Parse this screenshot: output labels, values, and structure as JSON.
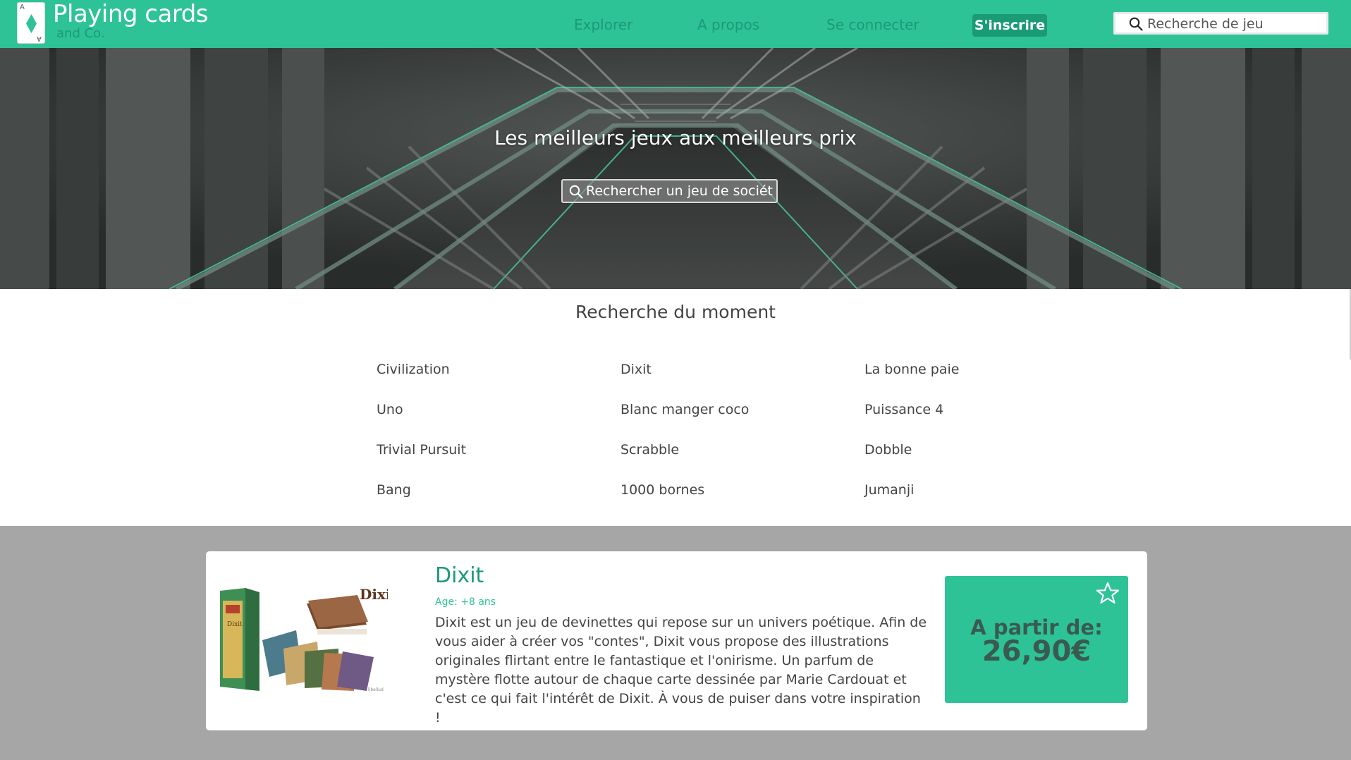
{
  "brand": {
    "title": "Playing cards",
    "subtitle": "and Co.",
    "card_corner": "A",
    "accent_color": "#2ec396",
    "dark_accent_color": "#1a9a75"
  },
  "nav": {
    "explorer": "Explorer",
    "about": "A propos",
    "login": "Se connecter",
    "signup": "S'inscrire"
  },
  "header_search": {
    "placeholder": "Recherche de jeu",
    "icon": "search-icon"
  },
  "hero": {
    "title": "Les meilleurs jeux aux meilleurs prix",
    "search_placeholder": "Rechercher un jeu de société",
    "icon": "search-icon"
  },
  "trending": {
    "title": "Recherche du moment",
    "columns": [
      [
        "Civilization",
        "Uno",
        "Trivial Pursuit",
        "Bang"
      ],
      [
        "Dixit",
        "Blanc manger coco",
        "Scrabble",
        "1000 bornes"
      ],
      [
        "La bonne paie",
        "Puissance 4",
        "Dobble",
        "Jumanji"
      ]
    ]
  },
  "product": {
    "name": "Dixit",
    "age": "Age: +8 ans",
    "description": "Dixit est un jeu de devinettes qui repose sur un univers poétique. Afin de vous aider à créer vos \"contes\", Dixit vous propose des illustrations originales flirtant entre le fantastique et l'onirisme. Un parfum de mystère flotte autour de chaque carte dessinée par Marie Cardouat et c'est ce qui fait l'intérêt de Dixit. À vous de puiser dans votre inspiration !",
    "image_logo": "Dixit",
    "image_publisher": "libellud",
    "price_label": "A partir de:",
    "price": "26,90€",
    "favorite_icon": "star-icon"
  }
}
